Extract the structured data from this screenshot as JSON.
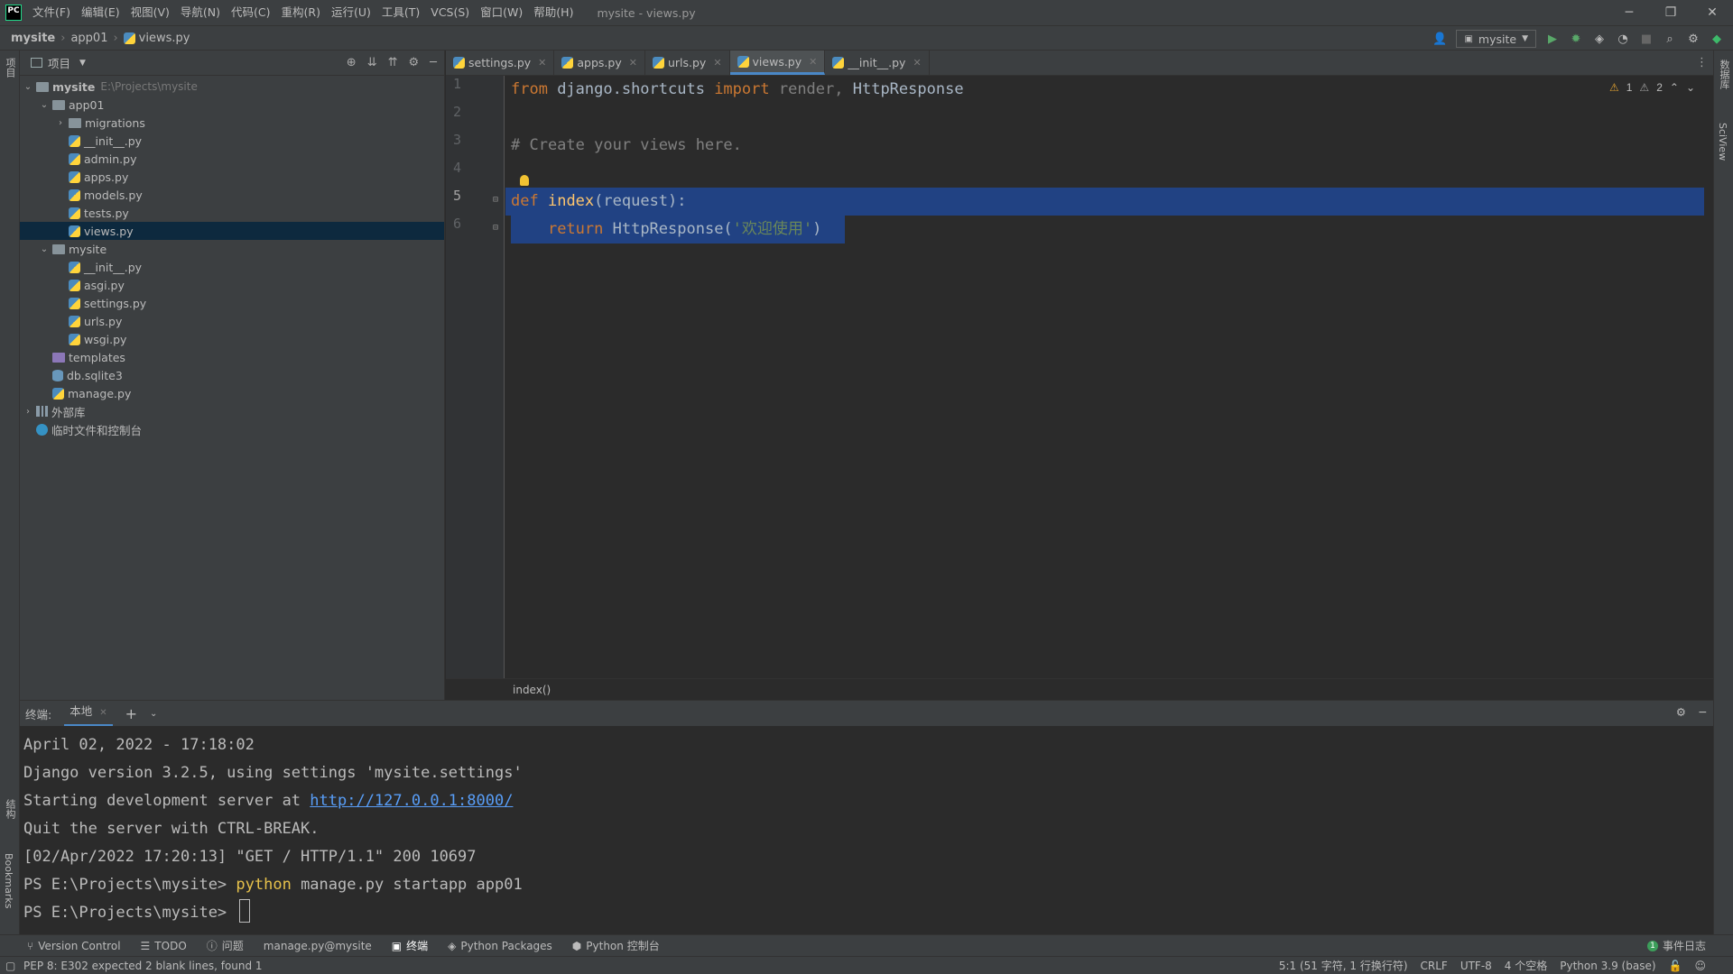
{
  "app": {
    "logo": "PC",
    "menus": [
      "文件(F)",
      "编辑(E)",
      "视图(V)",
      "导航(N)",
      "代码(C)",
      "重构(R)",
      "运行(U)",
      "工具(T)",
      "VCS(S)",
      "窗口(W)",
      "帮助(H)"
    ],
    "window_title": "mysite - views.py"
  },
  "navbar": {
    "crumbs": [
      "mysite",
      "app01",
      "views.py"
    ],
    "run_config": "mysite"
  },
  "stripes": {
    "left_top": "项目",
    "left_structure": "结构",
    "left_bookmarks": "Bookmarks",
    "right_db": "数据库",
    "right_sciview": "SciView"
  },
  "project": {
    "header": "项目",
    "tree": [
      {
        "label": "mysite",
        "path": "E:\\Projects\\mysite"
      },
      {
        "label": "app01"
      },
      {
        "label": "migrations"
      },
      {
        "label": "__init__.py"
      },
      {
        "label": "admin.py"
      },
      {
        "label": "apps.py"
      },
      {
        "label": "models.py"
      },
      {
        "label": "tests.py"
      },
      {
        "label": "views.py"
      },
      {
        "label": "mysite"
      },
      {
        "label": "__init__.py"
      },
      {
        "label": "asgi.py"
      },
      {
        "label": "settings.py"
      },
      {
        "label": "urls.py"
      },
      {
        "label": "wsgi.py"
      },
      {
        "label": "templates"
      },
      {
        "label": "db.sqlite3"
      },
      {
        "label": "manage.py"
      },
      {
        "label": "外部库"
      },
      {
        "label": "临时文件和控制台"
      }
    ]
  },
  "tabs": [
    "settings.py",
    "apps.py",
    "urls.py",
    "views.py",
    "__init__.py"
  ],
  "editor": {
    "line_numbers": [
      "1",
      "2",
      "3",
      "4",
      "5",
      "6"
    ],
    "line1": {
      "from": "from",
      "module": " django.shortcuts ",
      "import": "import",
      "render": " render, ",
      "rest": "HttpResponse"
    },
    "line3": "# Create your views here.",
    "line5": {
      "def": "def",
      "name": "index",
      "args": "(request):"
    },
    "line6": {
      "indent": "    ",
      "ret": "return",
      "call": " HttpResponse(",
      "str": "'欢迎使用'",
      "close": ")"
    },
    "warnings": "1",
    "weak_warnings": "2",
    "breadcrumb": "index()"
  },
  "terminal": {
    "label": "终端:",
    "tab": "本地",
    "lines": {
      "l1": "April 02, 2022 - 17:18:02",
      "l2": "Django version 3.2.5, using settings 'mysite.settings'",
      "l3_prefix": "Starting development server at ",
      "l3_link": "http://127.0.0.1:8000/",
      "l4": "Quit the server with CTRL-BREAK.",
      "l5": "[02/Apr/2022 17:20:13] \"GET / HTTP/1.1\" 200 10697",
      "l6_prompt": "PS E:\\Projects\\mysite> ",
      "l6_cmd": "python",
      "l6_rest": " manage.py startapp app01",
      "l7_prompt": "PS E:\\Projects\\mysite> "
    }
  },
  "toolwindows": [
    "Version Control",
    "TODO",
    "问题",
    "manage.py@mysite",
    "终端",
    "Python Packages",
    "Python 控制台"
  ],
  "event_log": {
    "count": "1",
    "label": "事件日志"
  },
  "status": {
    "message": "PEP 8: E302 expected 2 blank lines, found 1",
    "position": "5:1 (51 字符, 1 行换行符)",
    "line_sep": "CRLF",
    "encoding": "UTF-8",
    "indent": "4 个空格",
    "interpreter": "Python 3.9 (base)"
  }
}
